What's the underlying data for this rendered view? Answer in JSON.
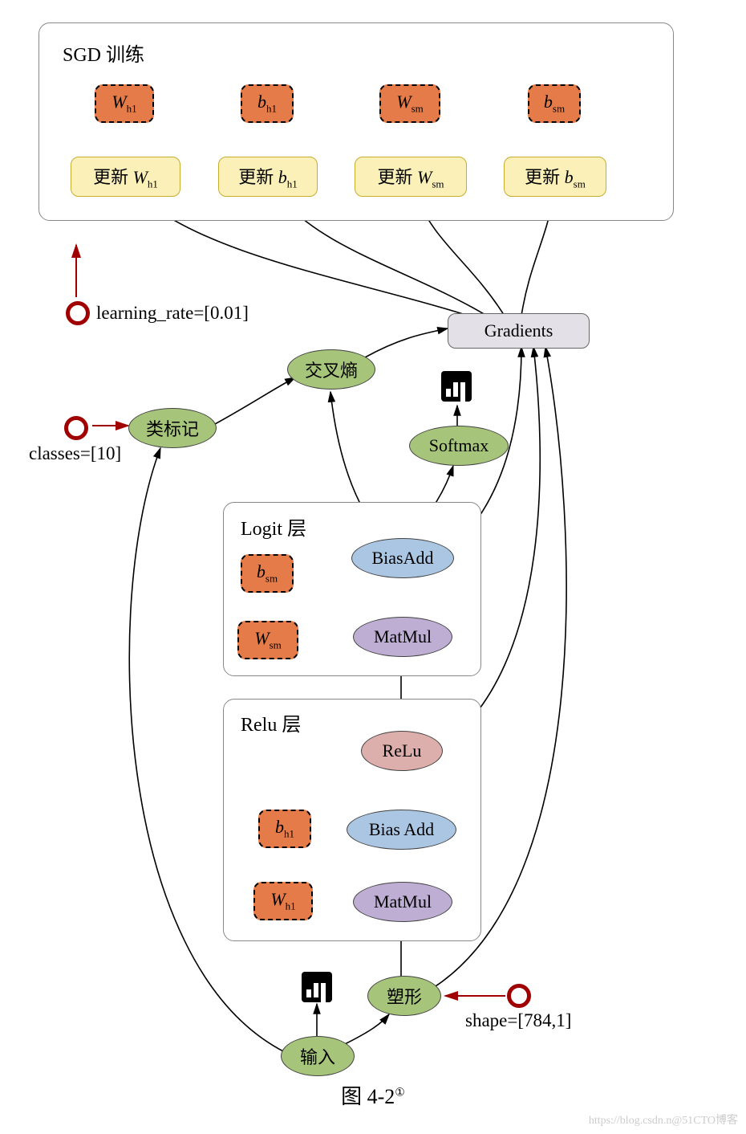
{
  "sgd": {
    "title": "SGD 训练",
    "params": [
      "W_h1",
      "b_h1",
      "W_sm",
      "b_sm"
    ],
    "updates": [
      "更新 W_h1",
      "更新 b_h1",
      "更新 W_sm",
      "更新 b_sm"
    ]
  },
  "learning_rate": "learning_rate=[0.01]",
  "classes": "classes=[10]",
  "shape": "shape=[784,1]",
  "gradients": "Gradients",
  "cross_entropy": "交叉熵",
  "class_label": "类标记",
  "softmax": "Softmax",
  "logit": {
    "title": "Logit 层",
    "bsm": "b_sm",
    "wsm": "W_sm",
    "biasadd": "BiasAdd",
    "matmul": "MatMul"
  },
  "relu": {
    "title": "Relu 层",
    "bh1": "b_h1",
    "wh1": "W_h1",
    "relu": "ReLu",
    "biasadd": "Bias Add",
    "matmul": "MatMul"
  },
  "reshape": "塑形",
  "input": "输入",
  "caption": "图 4-2",
  "caption_sup": "①",
  "watermark": "https://blog.csdn.n@51CTO博客"
}
